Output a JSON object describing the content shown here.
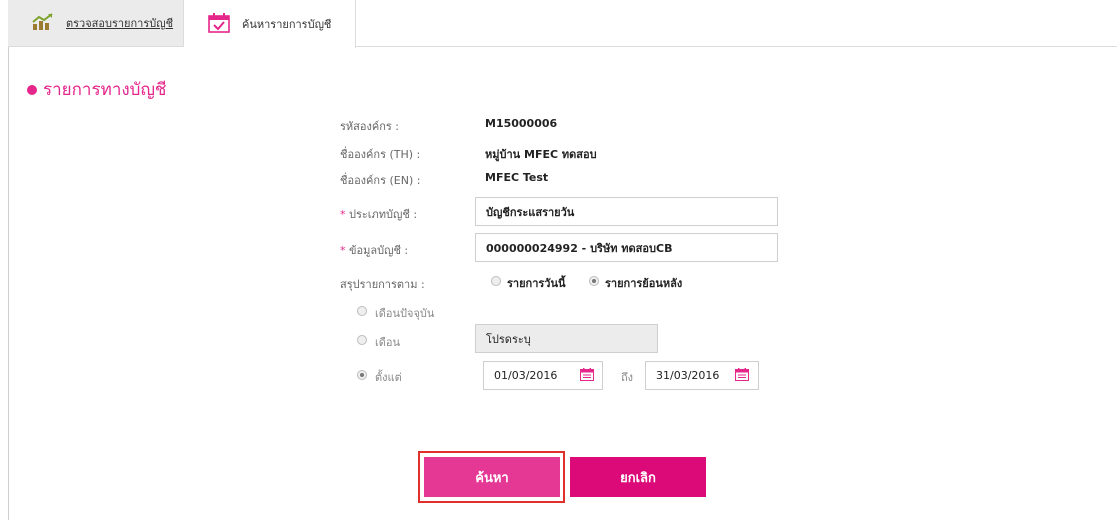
{
  "tabs": [
    {
      "label": "ตรวจสอบรายการบัญชี",
      "icon": "chart-icon"
    },
    {
      "label": "ค้นหารายการบัญชี",
      "icon": "calendar-check-icon"
    }
  ],
  "section": {
    "title": "รายการทางบัญชี",
    "bullet_color": "#e5268b"
  },
  "org": {
    "code_label": "รหัสองค์กร :",
    "code_value": "M15000006",
    "name_th_label": "ชื่อองค์กร (TH) :",
    "name_th_value": "หมู่บ้าน MFEC ทดสอบ",
    "name_en_label": "ชื่อองค์กร (EN) :",
    "name_en_value": "MFEC Test"
  },
  "form": {
    "required_mark": "*",
    "account_type_label": " ประเภทบัญชี :",
    "account_type_value": "บัญชีกระแสรายวัน",
    "account_info_label": " ข้อมูลบัญชี :",
    "account_info_value": "000000024992 - บริษัท ทดสอบCB",
    "summary_label": "สรุปรายการตาม :",
    "summary_options": [
      {
        "label": "รายการวันนี้",
        "selected": false
      },
      {
        "label": "รายการย้อนหลัง",
        "selected": true
      }
    ],
    "period_current_label": "เดือนปัจจุบัน",
    "period_current_selected": false,
    "period_month_label": "เดือน",
    "period_month_selected": false,
    "month_placeholder": "โปรดระบุ",
    "period_range_label": "ตั้งแต่",
    "period_range_selected": true,
    "date_from": "01/03/2016",
    "date_to_label": "ถึง",
    "date_to": "31/03/2016"
  },
  "buttons": {
    "search": "ค้นหา",
    "cancel": "ยกเลิก"
  },
  "colors": {
    "accent": "#e5268b",
    "search_bg": "#e53895",
    "cancel_bg": "#dc0a78",
    "highlight": "#e0302c"
  }
}
